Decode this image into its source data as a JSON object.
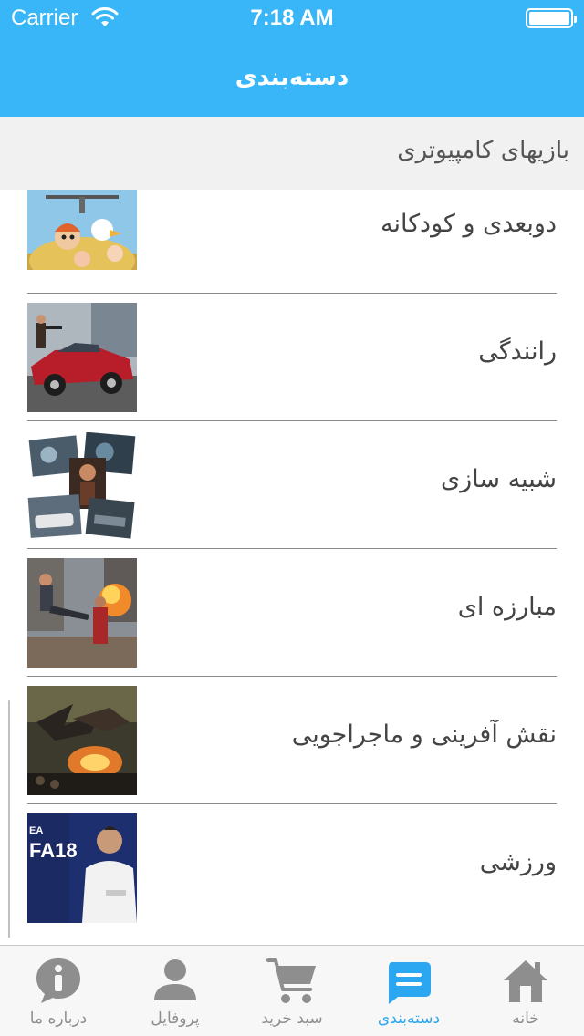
{
  "status_bar": {
    "carrier": "Carrier",
    "time": "7:18 AM"
  },
  "header": {
    "title": "دسته‌بندی",
    "background": "#38b6f8"
  },
  "section": {
    "title": "بازیهای کامپیوتری"
  },
  "categories": [
    {
      "label": "دوبعدی و کودکانه",
      "icon": "animated-kids-thumbnail"
    },
    {
      "label": "رانندگی",
      "icon": "racing-car-thumbnail"
    },
    {
      "label": "شبیه سازی",
      "icon": "simulation-collage-thumbnail"
    },
    {
      "label": "مبارزه ای",
      "icon": "fighting-thumbnail"
    },
    {
      "label": "نقش آفرینی و ماجراجویی",
      "icon": "dragon-rpg-thumbnail"
    },
    {
      "label": "ورزشی",
      "icon": "fifa-18-thumbnail"
    }
  ],
  "tab_bar": {
    "active_color": "#2aa7f0",
    "inactive_color": "#8e8e8e",
    "tabs": [
      {
        "label": "درباره ما",
        "icon": "info-icon"
      },
      {
        "label": "پروفایل",
        "icon": "profile-icon"
      },
      {
        "label": "سبد خرید",
        "icon": "cart-icon"
      },
      {
        "label": "دسته‌بندی",
        "icon": "category-icon",
        "active": true
      },
      {
        "label": "خانه",
        "icon": "home-icon"
      }
    ]
  }
}
